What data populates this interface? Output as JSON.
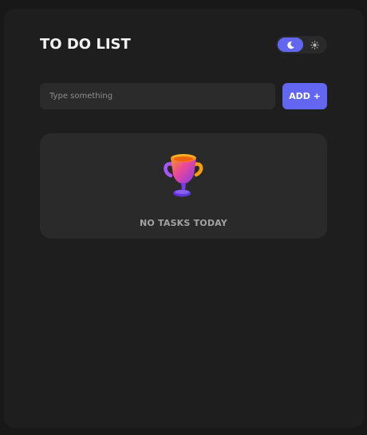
{
  "header": {
    "title": "TO DO LIST"
  },
  "theme_toggle": {
    "active": "dark",
    "dark_icon": "moon-icon",
    "light_icon": "sun-icon"
  },
  "new_task": {
    "placeholder": "Type something",
    "value": "",
    "add_label": "ADD +"
  },
  "tasks": [],
  "empty_state": {
    "icon": "trophy-icon",
    "message": "NO TASKS TODAY"
  },
  "colors": {
    "accent": "#6366f1",
    "background": "#1e1e1e",
    "card": "#2a2a2a"
  }
}
